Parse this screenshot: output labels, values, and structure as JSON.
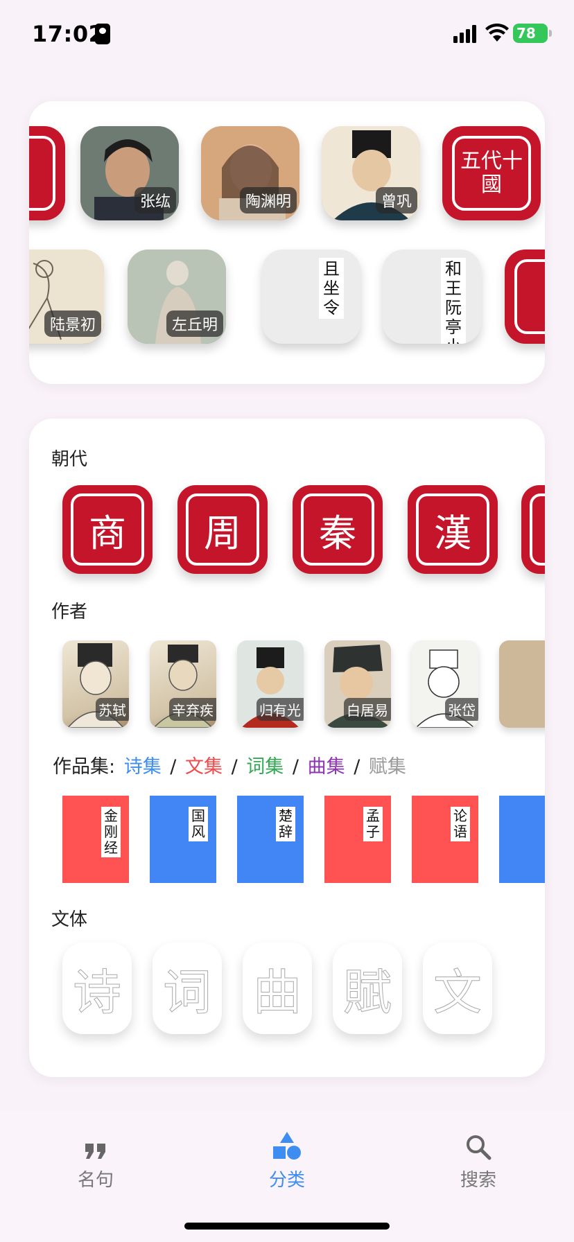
{
  "status_bar": {
    "time": "17:02",
    "battery": "78"
  },
  "featured": {
    "row1": [
      {
        "name": "",
        "type": "seal",
        "glyph": ""
      },
      {
        "name": "张纮",
        "type": "portrait"
      },
      {
        "name": "陶渊明",
        "type": "portrait"
      },
      {
        "name": "曾巩",
        "type": "portrait"
      },
      {
        "name": "五代十國",
        "type": "seal",
        "glyph": "五代十國"
      }
    ],
    "row2": [
      {
        "name": "陆景初",
        "type": "portrait"
      },
      {
        "name": "左丘明",
        "type": "portrait"
      },
      {
        "name": "且坐令",
        "type": "blank"
      },
      {
        "name": "和王阮亭小",
        "type": "blank"
      },
      {
        "name": "",
        "type": "seal",
        "glyph": ""
      }
    ]
  },
  "sections": {
    "dynasty_title": "朝代",
    "author_title": "作者",
    "works_title": "作品集:",
    "style_title": "文体"
  },
  "dynasties": [
    "商",
    "周",
    "秦",
    "漢"
  ],
  "authors": [
    "苏轼",
    "辛弃疾",
    "归有光",
    "白居易",
    "张岱"
  ],
  "works_links": [
    {
      "label": "诗集",
      "color": "#3d8ef0"
    },
    {
      "label": "文集",
      "color": "#f04a4a"
    },
    {
      "label": "词集",
      "color": "#33a852"
    },
    {
      "label": "曲集",
      "color": "#8e34b3"
    },
    {
      "label": "赋集",
      "color": "#999999"
    }
  ],
  "separator": "/",
  "books": [
    {
      "label": "金刚经",
      "color": "#ff5252"
    },
    {
      "label": "国风",
      "color": "#4285f4"
    },
    {
      "label": "楚辞",
      "color": "#4285f4"
    },
    {
      "label": "孟子",
      "color": "#ff5252"
    },
    {
      "label": "论语",
      "color": "#ff5252"
    },
    {
      "label": "",
      "color": "#4285f4"
    }
  ],
  "styles": [
    "诗",
    "词",
    "曲",
    "賦",
    "文"
  ],
  "tabs": [
    {
      "label": "名句",
      "icon": "quote-icon",
      "active": false
    },
    {
      "label": "分类",
      "icon": "category-icon",
      "active": true
    },
    {
      "label": "搜索",
      "icon": "search-icon",
      "active": false
    }
  ],
  "colors": {
    "accent": "#3d8ef0",
    "seal_red": "#c5152a",
    "inactive": "#777777"
  }
}
